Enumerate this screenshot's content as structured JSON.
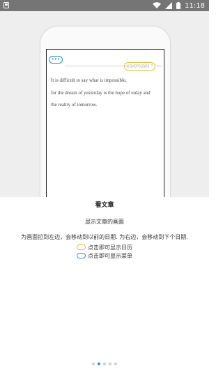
{
  "status_bar": {
    "time": "11:18",
    "icons": [
      "notification-icon",
      "wifi-icon",
      "signal-icon",
      "battery-icon"
    ]
  },
  "preview": {
    "menu_pill_label": "•••",
    "date": "03/07/2017",
    "article_lines": [
      "It is difficult to say what is impossible,",
      "for the dream of yesterday is the hope of today and",
      "the reality of tomorrow."
    ]
  },
  "guide": {
    "title": "看文章",
    "subtitle": "显示文章的画面",
    "description": "为画面拉到左边，会移动到以前的日期. 为右边，会移动到下个日期.",
    "legend": [
      {
        "label": "点击即可显示日历",
        "color": "#e3c53c"
      },
      {
        "label": "点击即可显示菜单",
        "color": "#2e8fd6"
      }
    ]
  },
  "pager": {
    "page_count": 5,
    "active_index": 1
  },
  "colors": {
    "accent_blue": "#2e8fd6",
    "accent_yellow": "#e3c53c",
    "status_bar": "#757575"
  }
}
